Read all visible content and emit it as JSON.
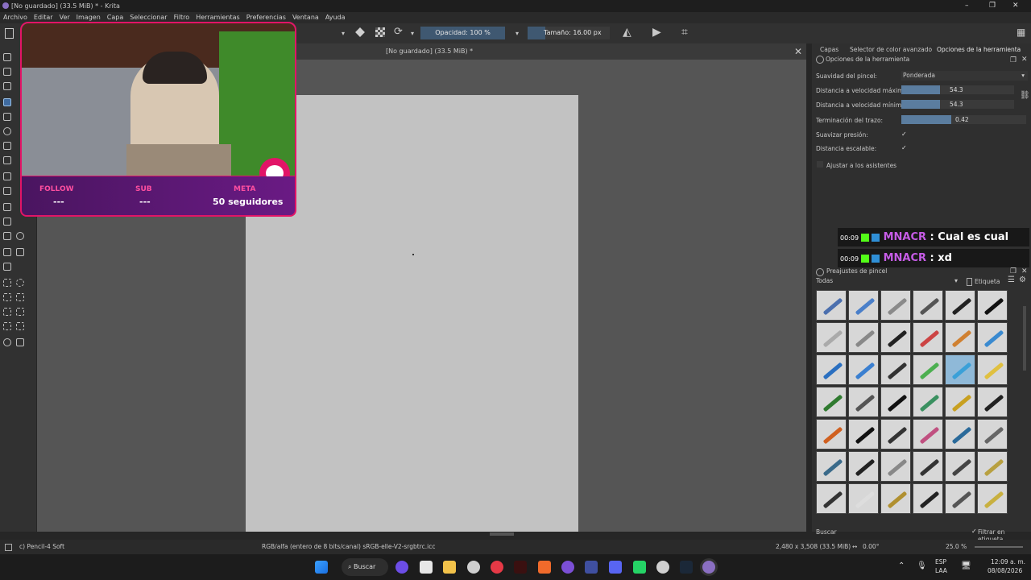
{
  "window": {
    "title": "[No guardado]  (33.5 MiB) * - Krita",
    "minimize": "–",
    "maximize": "❐",
    "close": "✕"
  },
  "menu": [
    "Archivo",
    "Editar",
    "Ver",
    "Imagen",
    "Capa",
    "Seleccionar",
    "Filtro",
    "Herramientas",
    "Preferencias",
    "Ventana",
    "Ayuda"
  ],
  "toolbar": {
    "opacity": "Opacidad: 100 %",
    "size": "Tamaño: 16.00 px"
  },
  "document": {
    "tab": "[No guardado]  (33.5 MiB) *",
    "close": "✕"
  },
  "dock": {
    "tabs": [
      "Capas",
      "Selector de color avanzado",
      "Opciones de la herramienta"
    ],
    "tool_options_title": "Opciones de la herramienta",
    "smoothing_label": "Suavidad del pincel:",
    "smoothing_value": "Ponderada",
    "max_dist_label": "Distancia a velocidad máxima:",
    "max_dist_value": "54.3",
    "min_dist_label": "Distancia a velocidad mínima:",
    "min_dist_value": "54.3",
    "stroke_end_label": "Terminación del trazo:",
    "stroke_end_value": "0.42",
    "pressure_label": "Suavizar presión:",
    "scalable_label": "Distancia escalable:",
    "checkmark": "✓",
    "assistants_label": "Ajustar a los asistentes"
  },
  "chat": [
    {
      "time": "00:09",
      "user": "MNACR",
      "message": " : Cual es cual"
    },
    {
      "time": "00:09",
      "user": "MNACR",
      "message": " : xd"
    }
  ],
  "presets": {
    "title": "Preajustes de pincel",
    "filter": "Todas",
    "tag": "Etiqueta",
    "search": "Buscar",
    "filter_tag": "Filtrar en etiqueta"
  },
  "overlay": {
    "follow_label": "FOLLOW",
    "follow_value": "---",
    "sub_label": "SUB",
    "sub_value": "---",
    "meta_label": "META",
    "meta_value": "50 seguidores"
  },
  "status": {
    "brush": "c) Pencil-4 Soft",
    "color": "RGB/alfa (entero de 8 bits/canal)  sRGB-elle-V2-srgbtrc.icc",
    "size": "2,480 x 3,508 (33.5 MiB)",
    "rotation": "0.00°",
    "zoom": "25.0 %"
  },
  "taskbar": {
    "search": "Buscar",
    "lang": "ESP",
    "region": "LAA",
    "time": "12:09 a. m.",
    "date": "08/08/2026"
  },
  "colors": {
    "accent": "#3f5871",
    "overlay_border": "#e21467",
    "chat_user": "#c65ce6"
  }
}
